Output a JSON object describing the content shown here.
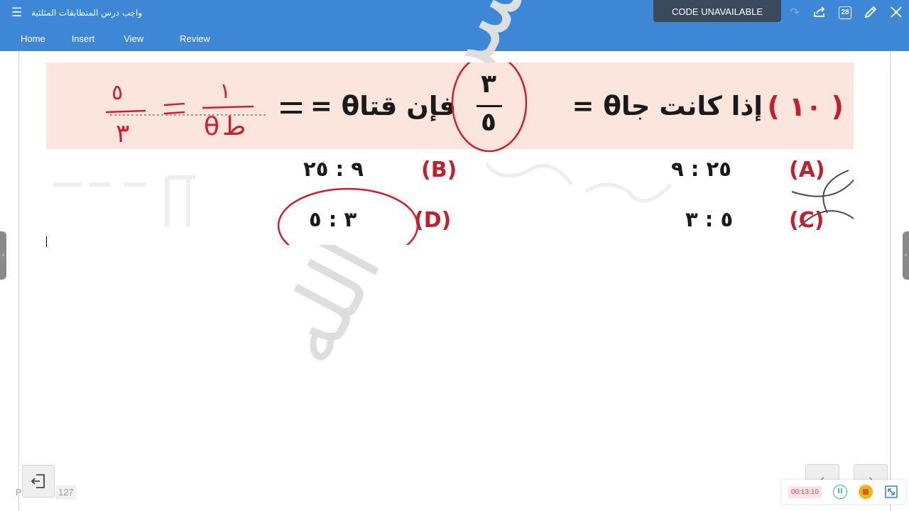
{
  "app": {
    "title": "واجب درس المتطابقات المثلثية",
    "menu_icon": "hamburger-icon",
    "tabs": [
      {
        "label": "Home"
      },
      {
        "label": "Insert"
      },
      {
        "label": "View"
      },
      {
        "label": "Review"
      }
    ],
    "code_banner": "CODE UNAVAILABLE",
    "toolbar": {
      "undo_icon": "undo-icon",
      "redo_icon": "redo-icon",
      "share_icon": "share-icon",
      "pages_badge": "28",
      "pen_icon": "pen-icon",
      "close_icon": "close-icon"
    }
  },
  "worksheet": {
    "question_number": "( ١٠ )",
    "question_text": "إذا كانت جاθ =",
    "question_suffix": "فإن قتاθ =",
    "fraction": {
      "numerator": "٣",
      "denominator": "٥"
    },
    "handwritten_work": {
      "left": "٥/٣",
      "right": "١/جاθ"
    },
    "options": [
      {
        "letter": "(A)",
        "value": "٢٥ : ٩"
      },
      {
        "letter": "(B)",
        "value": "٩ : ٢٥"
      },
      {
        "letter": "(C)",
        "value": "٥ : ٣"
      },
      {
        "letter": "(D)",
        "value": "٣ : ٥"
      }
    ],
    "selected_option": "(D)",
    "accent_color": "#c3202d",
    "band_color": "#fbe5dc"
  },
  "watermark": {
    "text": "حسن عبد الله"
  },
  "bottom": {
    "exit_icon": "exit-icon",
    "page_prefix": "P",
    "page_number": "127",
    "prev_icon": "chevron-left-icon",
    "next_icon": "chevron-right-icon"
  },
  "recorder": {
    "time": "00:13:10",
    "pause_icon": "pause-icon",
    "stop_icon": "stop-icon",
    "expand_icon": "expand-icon"
  }
}
